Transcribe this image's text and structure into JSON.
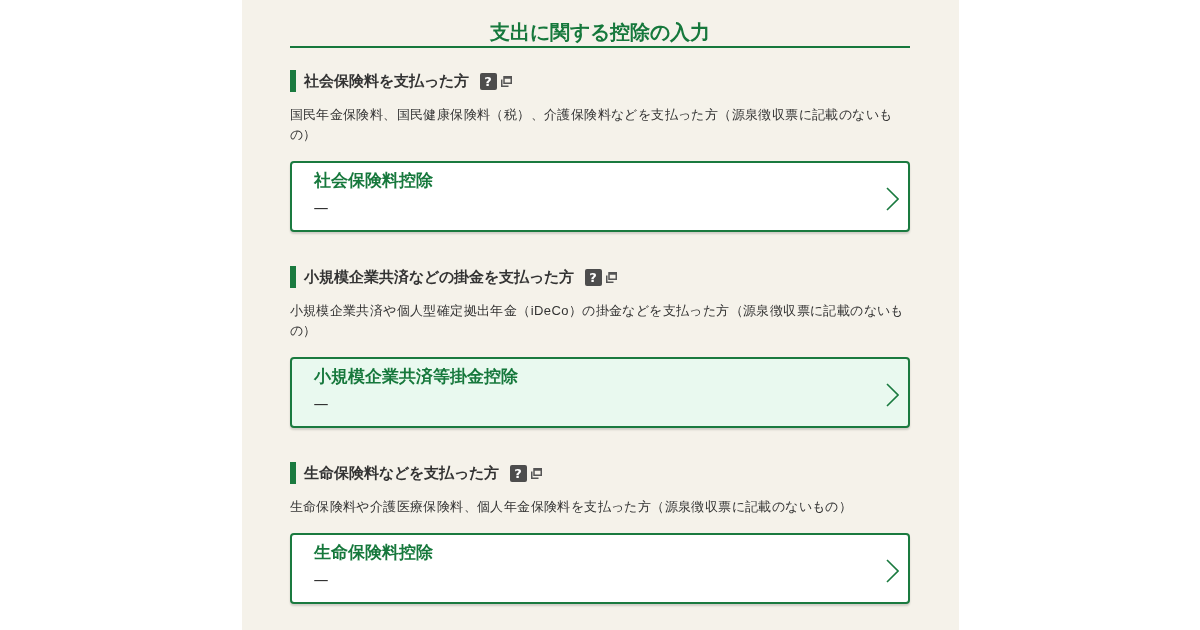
{
  "page_title": "支出に関する控除の入力",
  "sections": [
    {
      "heading": "社会保険料を支払った方",
      "help_mark": "?",
      "description": "国民年金保険料、国民健康保険料（税）、介護保険料などを支払った方（源泉徴収票に記載のないもの）",
      "card": {
        "title": "社会保険料控除",
        "value": "—",
        "highlighted": false
      }
    },
    {
      "heading": "小規模企業共済などの掛金を支払った方",
      "help_mark": "?",
      "description": "小規模企業共済や個人型確定拠出年金（iDeCo）の掛金などを支払った方（源泉徴収票に記載のないもの）",
      "card": {
        "title": "小規模企業共済等掛金控除",
        "value": "—",
        "highlighted": true
      }
    },
    {
      "heading": "生命保険料などを支払った方",
      "help_mark": "?",
      "description": "生命保険料や介護医療保険料、個人年金保険料を支払った方（源泉徴収票に記載のないもの）",
      "card": {
        "title": "生命保険料控除",
        "value": "—",
        "highlighted": false
      }
    }
  ]
}
